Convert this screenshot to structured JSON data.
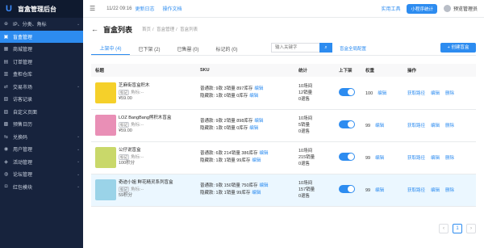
{
  "app": {
    "title": "盲盒管理后台",
    "logo": "U"
  },
  "sidebar": {
    "items": [
      {
        "icon": "globe-icon",
        "glyph": "⊕",
        "label": "IP、分类、角标",
        "has_children": true,
        "active": false
      },
      {
        "icon": "box-icon",
        "glyph": "▣",
        "label": "盲盒管理",
        "has_children": false,
        "active": true
      },
      {
        "icon": "shop-icon",
        "glyph": "▦",
        "label": "商城管理",
        "has_children": false,
        "active": false
      },
      {
        "icon": "order-icon",
        "glyph": "▤",
        "label": "订单管理",
        "has_children": false,
        "active": false
      },
      {
        "icon": "warehouse-icon",
        "glyph": "▥",
        "label": "盒柜仓库",
        "has_children": false,
        "active": false
      },
      {
        "icon": "market-icon",
        "glyph": "⇄",
        "label": "交易市场",
        "has_children": true,
        "active": false
      },
      {
        "icon": "record-icon",
        "glyph": "▧",
        "label": "访客记录",
        "has_children": false,
        "active": false
      },
      {
        "icon": "page-icon",
        "glyph": "▨",
        "label": "自定义页面",
        "has_children": false,
        "active": false
      },
      {
        "icon": "calendar-icon",
        "glyph": "▩",
        "label": "预售日历",
        "has_children": false,
        "active": false
      },
      {
        "icon": "exchange-icon",
        "glyph": "⇆",
        "label": "兑换码",
        "has_children": true,
        "active": false
      },
      {
        "icon": "user-icon",
        "glyph": "◉",
        "label": "用户管理",
        "has_children": true,
        "active": false
      },
      {
        "icon": "activity-icon",
        "glyph": "◈",
        "label": "活动管理",
        "has_children": true,
        "active": false
      },
      {
        "icon": "forum-icon",
        "glyph": "◍",
        "label": "论坛管理",
        "has_children": true,
        "active": false
      },
      {
        "icon": "redpacket-icon",
        "glyph": "◘",
        "label": "红包模块",
        "has_children": true,
        "active": false
      }
    ]
  },
  "topbar": {
    "time": "11/22 09:16",
    "changelog": "更新日志",
    "docs": "操作文档",
    "tools": "实用工具",
    "miniapp_btn": "小程序统计",
    "user": "预览管理员"
  },
  "page": {
    "title": "盲盒列表",
    "breadcrumb": [
      "首页",
      "盲盒管理",
      "盲盒列表"
    ]
  },
  "tabs": [
    {
      "label": "上架中 (4)",
      "active": true
    },
    {
      "label": "已下架 (2)",
      "active": false
    },
    {
      "label": "已售罄 (0)",
      "active": false
    },
    {
      "label": "标记的 (0)",
      "active": false
    }
  ],
  "search": {
    "placeholder": "输入关键字"
  },
  "global_config": "盲盒全局配置",
  "create_btn": "+ 创建盲盒",
  "table": {
    "headers": [
      "标题",
      "SKU",
      "统计",
      "上下架",
      "权重",
      "操作"
    ],
    "rows": [
      {
        "name": "芝麻街盲盒积木",
        "tag": "标记",
        "meta": "角标:--",
        "price": "¥59.00",
        "sku1": "普通款: 9款  3销量  897库存",
        "sku2": "隐藏款: 1款  0销量  0库存",
        "edit": "编辑",
        "stats": [
          "10场间",
          "12销量",
          "0退售"
        ],
        "weight": "100",
        "weight_edit": "编辑",
        "ops": [
          "获取路径",
          "编辑",
          "删除"
        ],
        "on": true,
        "thumb_color": "#f5d02a",
        "highlight": false
      },
      {
        "name": "LOZ BangBang熊积木盲盒",
        "tag": "标记",
        "meta": "角标:--",
        "price": "¥59.00",
        "sku1": "普通款: 9款  2销量  898库存",
        "sku2": "隐藏款: 1款  0销量  0库存",
        "edit": "编辑",
        "stats": [
          "10场间",
          "5销量",
          "0退售"
        ],
        "weight": "99",
        "weight_edit": "编辑",
        "ops": [
          "获取路径",
          "编辑",
          "删除"
        ],
        "on": true,
        "thumb_color": "#e98fb6",
        "highlight": false
      },
      {
        "name": "公仔说盲盒",
        "tag": "标记",
        "meta": "角标:--",
        "price": "100积分",
        "sku1": "普通款: 6款  214销量  386库存",
        "sku2": "隐藏款: 1款  1销量  99库存",
        "edit": "编辑",
        "stats": [
          "10场间",
          "215销量",
          "0退售"
        ],
        "weight": "99",
        "weight_edit": "编辑",
        "ops": [
          "获取路径",
          "编辑",
          "删除"
        ],
        "on": true,
        "thumb_color": "#c9d86a",
        "highlight": false
      },
      {
        "name": "奇迹小姐 鲜花精灵系列盲盒",
        "tag": "标记",
        "meta": "角标:--",
        "price": "59积分",
        "sku1": "普通款: 9款  150销量  750库存",
        "sku2": "隐藏款: 1款  1销量  99库存",
        "edit": "编辑",
        "stats": [
          "10场间",
          "157销量",
          "0退售"
        ],
        "weight": "99",
        "weight_edit": "编辑",
        "ops": [
          "获取路径",
          "编辑",
          "删除"
        ],
        "on": true,
        "thumb_color": "#9ad3e8",
        "highlight": true
      }
    ]
  },
  "pagination": {
    "prev": "‹",
    "current": "1",
    "next": "›"
  }
}
